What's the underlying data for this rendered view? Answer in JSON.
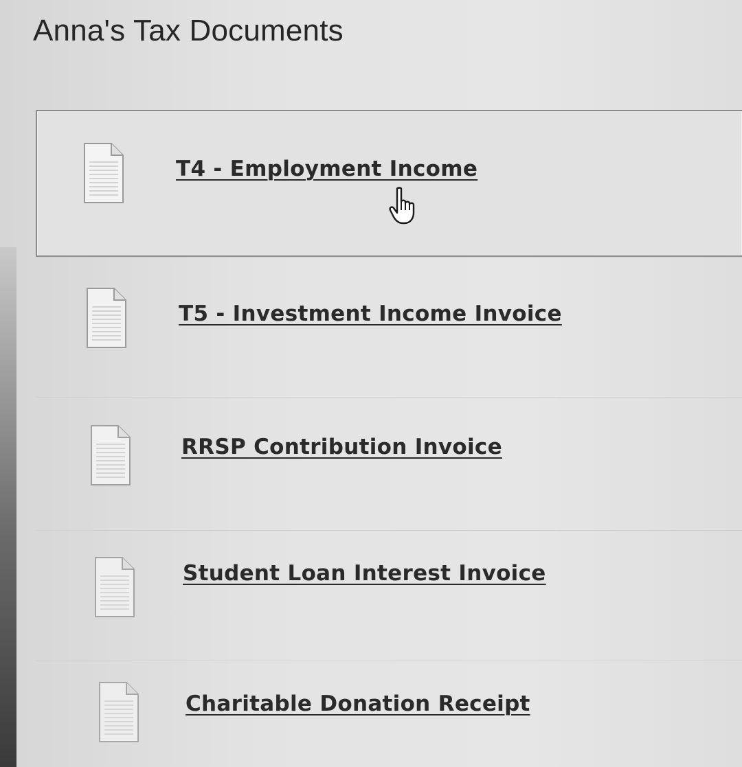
{
  "page": {
    "title": "Anna's Tax Documents"
  },
  "documents": [
    {
      "label": "T4 - Employment Income",
      "icon": "document-icon",
      "selected": true
    },
    {
      "label": "T5 - Investment Income Invoice",
      "icon": "document-icon",
      "selected": false
    },
    {
      "label": "RRSP Contribution Invoice",
      "icon": "document-icon",
      "selected": false
    },
    {
      "label": "Student Loan Interest Invoice",
      "icon": "document-icon",
      "selected": false
    },
    {
      "label": "Charitable Donation Receipt",
      "icon": "document-icon",
      "selected": false
    }
  ],
  "cursor": {
    "icon": "hand-pointer-icon"
  },
  "colors": {
    "text": "#262626",
    "selected_border": "#8a8a8a",
    "background": "#e3e3e3"
  }
}
